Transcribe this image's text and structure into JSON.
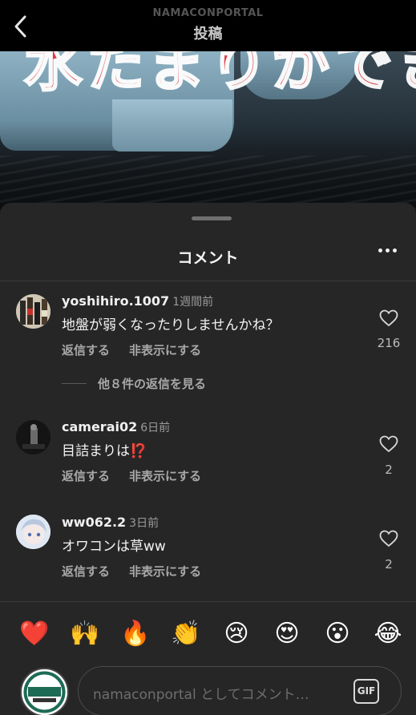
{
  "header": {
    "username": "NAMACONPORTAL",
    "title": "投稿"
  },
  "video": {
    "overlay_text": "水たまりができる"
  },
  "sheet": {
    "title": "コメント"
  },
  "comments": [
    {
      "username": "yoshihiro.1007",
      "time": "1週間前",
      "text": "地盤が弱くなったりしませんかね？",
      "reply_label": "返信する",
      "hide_label": "非表示にする",
      "likes": "216",
      "view_replies": "他８件の返信を見る"
    },
    {
      "username": "camerai02",
      "time": "6日前",
      "text": "目詰まりは⁉️",
      "reply_label": "返信する",
      "hide_label": "非表示にする",
      "likes": "2"
    },
    {
      "username": "ww062.2",
      "time": "3日前",
      "text": "オワコンは草ww",
      "reply_label": "返信する",
      "hide_label": "非表示にする",
      "likes": "2"
    }
  ],
  "emoji_reactions": [
    "❤️",
    "🙌",
    "🔥",
    "👏",
    "😢",
    "😍",
    "😮",
    "😂"
  ],
  "composer": {
    "placeholder": "namaconportal としてコメント…",
    "gif_label": "GIF"
  },
  "colors": {
    "sheet_bg": "#262626",
    "accent_red": "#e8323a"
  }
}
